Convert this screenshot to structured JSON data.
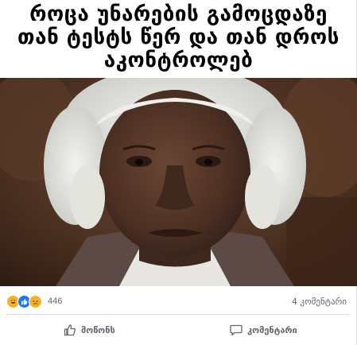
{
  "caption": {
    "line1": "როცა უნარების გამოცდაზე",
    "line2": "თან ტესტს წერ და თან დროს",
    "line3": "აკონტროლებ"
  },
  "reactions": {
    "icons": [
      "haha-icon",
      "like-icon",
      "sad-icon"
    ],
    "count": "446"
  },
  "comments_count": "4 კომენტარი",
  "actions": {
    "like_label": "მოწონს",
    "comment_label": "კომენტარი"
  },
  "colors": {
    "like_blue": "#1877f2",
    "reaction_yellow": "#f7b125",
    "meta_gray": "#606770"
  }
}
